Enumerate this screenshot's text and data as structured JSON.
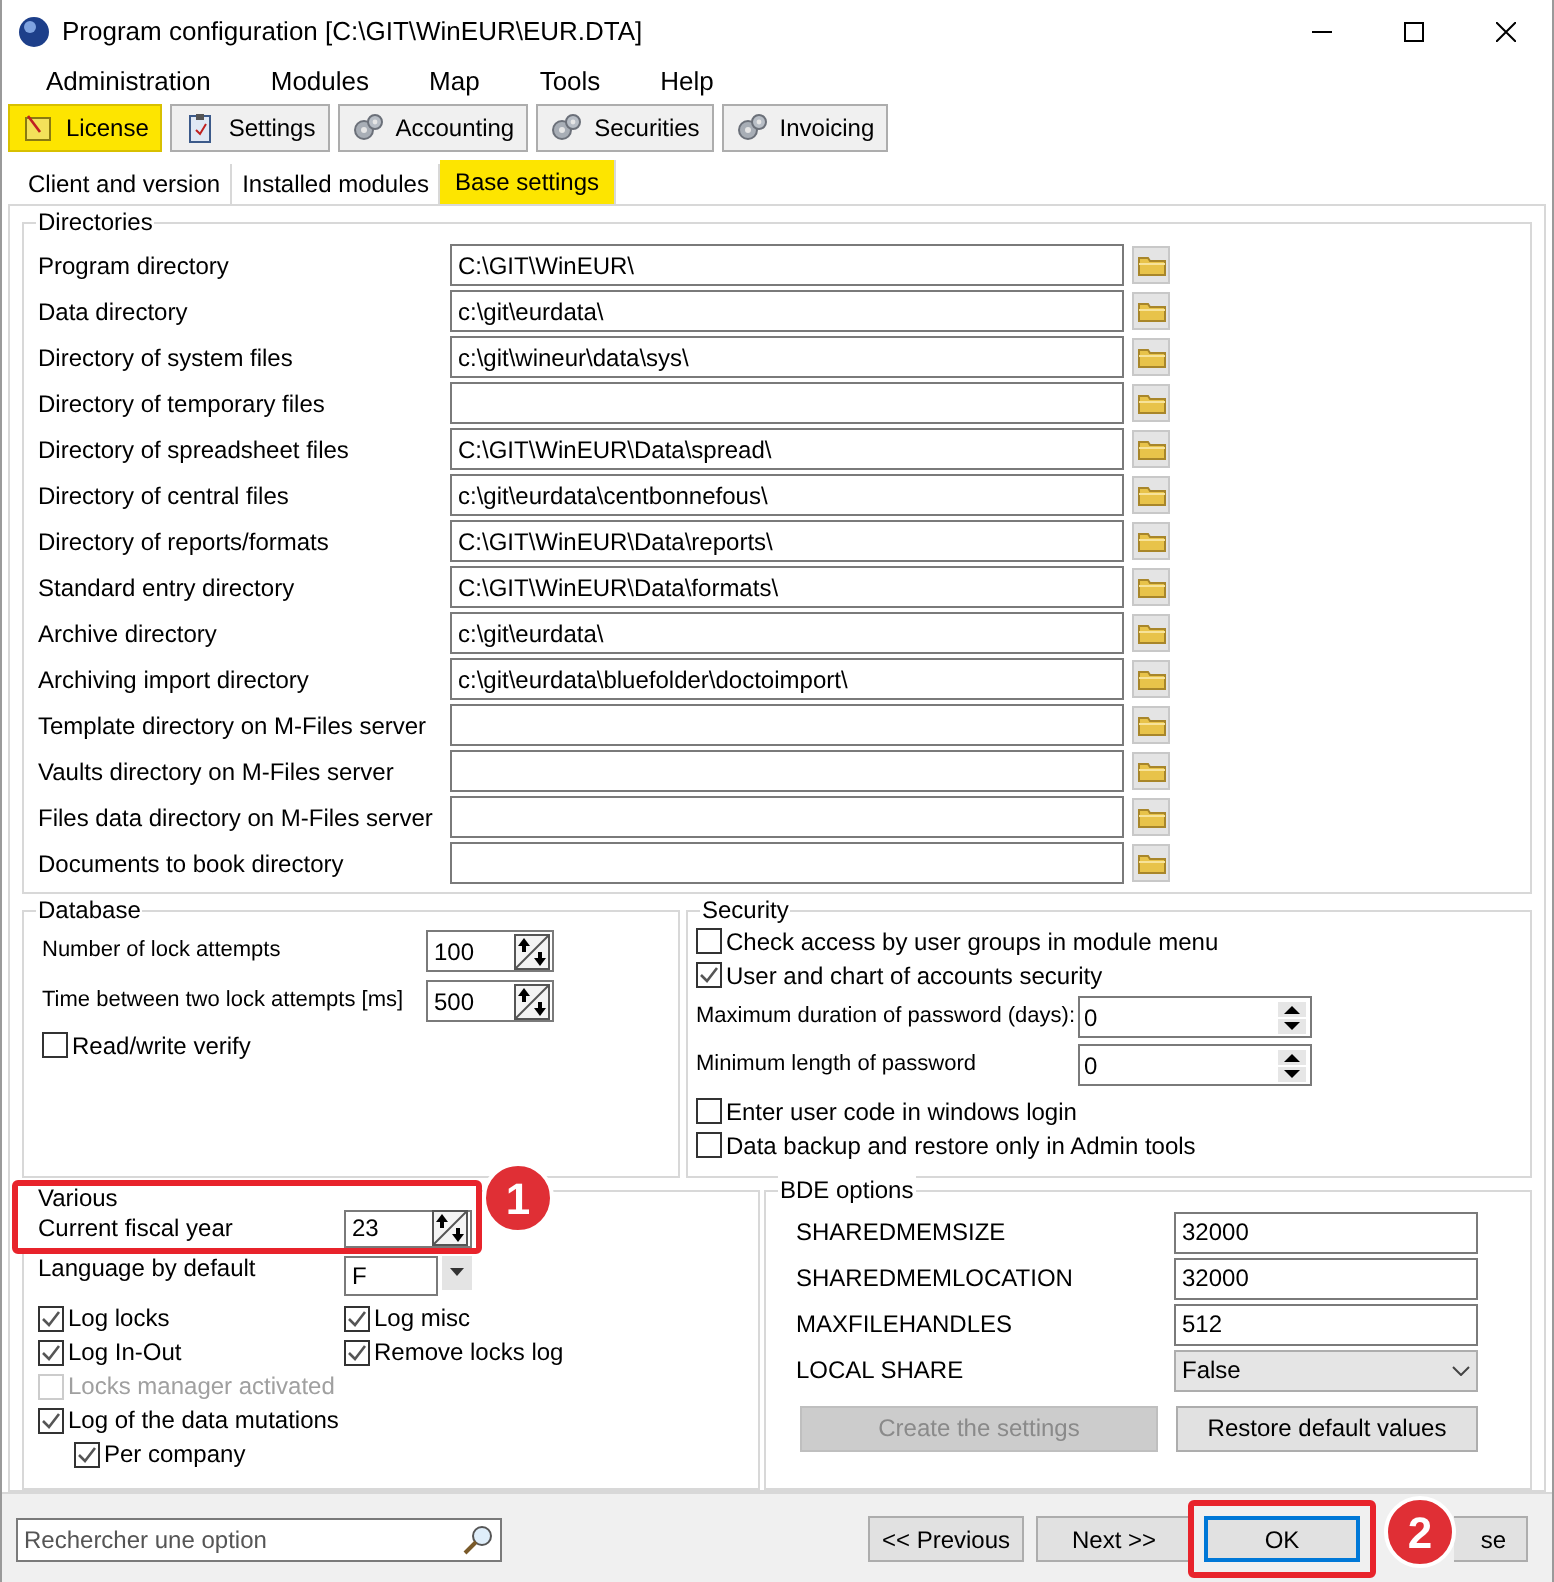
{
  "window": {
    "title": "Program configuration [C:\\GIT\\WinEUR\\EUR.DTA]"
  },
  "menu": [
    "Administration",
    "Modules",
    "Map",
    "Tools",
    "Help"
  ],
  "toolbar": [
    {
      "label": "License",
      "kind": "license",
      "selected": true
    },
    {
      "label": "Settings",
      "kind": "clipboard",
      "selected": false
    },
    {
      "label": "Accounting",
      "kind": "gears",
      "selected": false
    },
    {
      "label": "Securities",
      "kind": "gears",
      "selected": false
    },
    {
      "label": "Invoicing",
      "kind": "gears",
      "selected": false
    }
  ],
  "tabs": [
    {
      "label": "Client and version",
      "selected": false
    },
    {
      "label": "Installed modules",
      "selected": false
    },
    {
      "label": "Base settings",
      "selected": true
    }
  ],
  "directories": {
    "title": "Directories",
    "rows": [
      {
        "label": "Program directory",
        "value": "C:\\GIT\\WinEUR\\"
      },
      {
        "label": "Data directory",
        "value": "c:\\git\\eurdata\\"
      },
      {
        "label": "Directory of system files",
        "value": "c:\\git\\wineur\\data\\sys\\"
      },
      {
        "label": "Directory of temporary files"
      },
      {
        "label": "Directory of spreadsheet files",
        "value": "C:\\GIT\\WinEUR\\Data\\spread\\"
      },
      {
        "label": "Directory of central files",
        "value": "c:\\git\\eurdata\\centbonnefous\\"
      },
      {
        "label": "Directory of reports/formats",
        "value": "C:\\GIT\\WinEUR\\Data\\reports\\"
      },
      {
        "label": "Standard entry directory",
        "value": "C:\\GIT\\WinEUR\\Data\\formats\\"
      },
      {
        "label": "Archive directory",
        "value": "c:\\git\\eurdata\\"
      },
      {
        "label": "Archiving import directory",
        "value": "c:\\git\\eurdata\\bluefolder\\doctoimport\\"
      },
      {
        "label": "Template directory on M-Files server"
      },
      {
        "label": "Vaults directory on M-Files server"
      },
      {
        "label": "Files data directory on M-Files server"
      },
      {
        "label": "Documents to book directory"
      }
    ]
  },
  "database": {
    "title": "Database",
    "fields": [
      {
        "label": "Number of lock attempts",
        "value": "100"
      },
      {
        "label": "Time between two lock attempts [ms]",
        "value": "500"
      }
    ],
    "checkboxes": [
      {
        "label": "Read/write verify",
        "checked": false
      }
    ]
  },
  "security": {
    "title": "Security",
    "checkboxes_top": [
      {
        "label": "Check access by user groups in module menu",
        "checked": false
      },
      {
        "label": "User and chart of accounts security",
        "checked": true
      }
    ],
    "fields": [
      {
        "label": "Maximum duration of password (days):",
        "value": "0"
      },
      {
        "label": "Minimum length of password",
        "value": "0"
      }
    ],
    "checkboxes_bottom": [
      {
        "label": "Enter user code in windows login",
        "checked": false
      },
      {
        "label": "Data backup and restore only in Admin tools",
        "checked": false
      }
    ]
  },
  "various": {
    "title": "Various",
    "fiscal_year": {
      "label": "Current fiscal year",
      "value": "23"
    },
    "language": {
      "label": "Language by default",
      "value": "F"
    },
    "left_column": [
      {
        "label": "Log locks",
        "checked": true,
        "disabled": false
      },
      {
        "label": "Log In-Out",
        "checked": true,
        "disabled": false
      },
      {
        "label": "Locks manager activated",
        "checked": false,
        "disabled": true
      },
      {
        "label": "Log of the data mutations",
        "checked": true,
        "disabled": false,
        "children": [
          {
            "label": "Per company",
            "checked": true,
            "disabled": false
          }
        ]
      }
    ],
    "right_column": [
      {
        "label": "Log misc",
        "checked": true,
        "disabled": false
      },
      {
        "label": "Remove locks log",
        "checked": true,
        "disabled": false
      }
    ]
  },
  "bde": {
    "title": "BDE options",
    "fields": [
      {
        "label": "SHAREDMEMSIZE",
        "value": "32000",
        "kind": "text"
      },
      {
        "label": "SHAREDMEMLOCATION",
        "value": "32000",
        "kind": "text"
      },
      {
        "label": "MAXFILEHANDLES",
        "value": "512",
        "kind": "text"
      },
      {
        "label": "LOCAL SHARE",
        "value": "False",
        "kind": "select"
      }
    ],
    "buttons": [
      {
        "label": "Create the settings",
        "disabled": true
      },
      {
        "label": "Restore default values",
        "disabled": false
      }
    ]
  },
  "footer": {
    "search": {
      "placeholder": "Rechercher une option"
    },
    "buttons": [
      {
        "label": "<< Previous",
        "focused": false
      },
      {
        "label": "Next >>",
        "focused": false
      },
      {
        "label": "OK",
        "focused": true
      },
      {
        "label": "se",
        "focused": false
      }
    ]
  },
  "annotations": [
    {
      "label": "1"
    },
    {
      "label": "2"
    }
  ]
}
